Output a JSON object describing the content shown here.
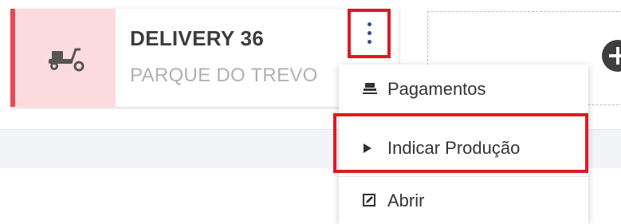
{
  "card": {
    "title": "DELIVERY 36",
    "subtitle": "PARQUE DO TREVO",
    "icon": "scooter-icon"
  },
  "menu": {
    "items": [
      {
        "label": "Pagamentos",
        "icon": "payments-icon"
      },
      {
        "label": "Indicar Produção",
        "icon": "play-icon"
      },
      {
        "label": "Abrir",
        "icon": "edit-icon"
      }
    ]
  },
  "colors": {
    "accent_red": "#e94957",
    "card_icon_bg": "#fcdbde",
    "highlight": "#e01924",
    "kebab_dots": "#2f4f8a"
  }
}
